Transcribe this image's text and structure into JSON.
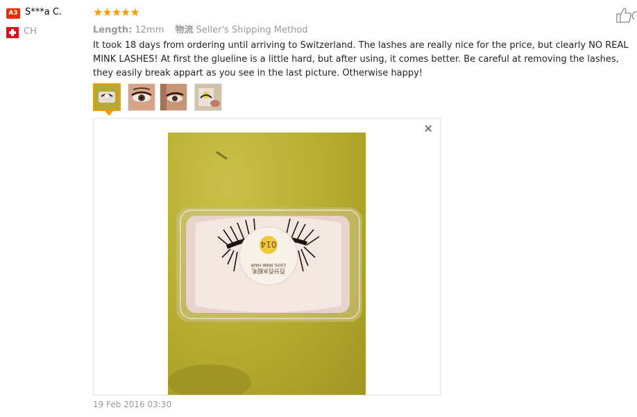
{
  "user": {
    "level_badge": "A3",
    "name": "S***a C.",
    "country": "CH",
    "flag_icon": "swiss-flag-icon"
  },
  "review": {
    "stars": "★★★★★",
    "rating": 5,
    "length_label": "Length:",
    "length_value": "12mm",
    "shipping_label": "物流",
    "shipping_value": "Seller's Shipping Method",
    "text": "It took 18 days from ordering until arriving to Switzerland. The lashes are really nice for the price, but clearly NO REAL MINK LASHES! At first the glueline is a little hard, but after using, it comes better. Be careful at removing the lashes, they easily break appart as you see in the last picture. Otherwise happy!",
    "date": "19 Feb 2016 03:30"
  },
  "viewer": {
    "close_glyph": "✕",
    "box_label_top": "100% MINK HAIR",
    "box_label_cn": "百分百水貂毛",
    "box_code": "014"
  },
  "colors": {
    "star": "#ff9a00",
    "badge": "#e62e04",
    "active_border": "#ff9900"
  }
}
